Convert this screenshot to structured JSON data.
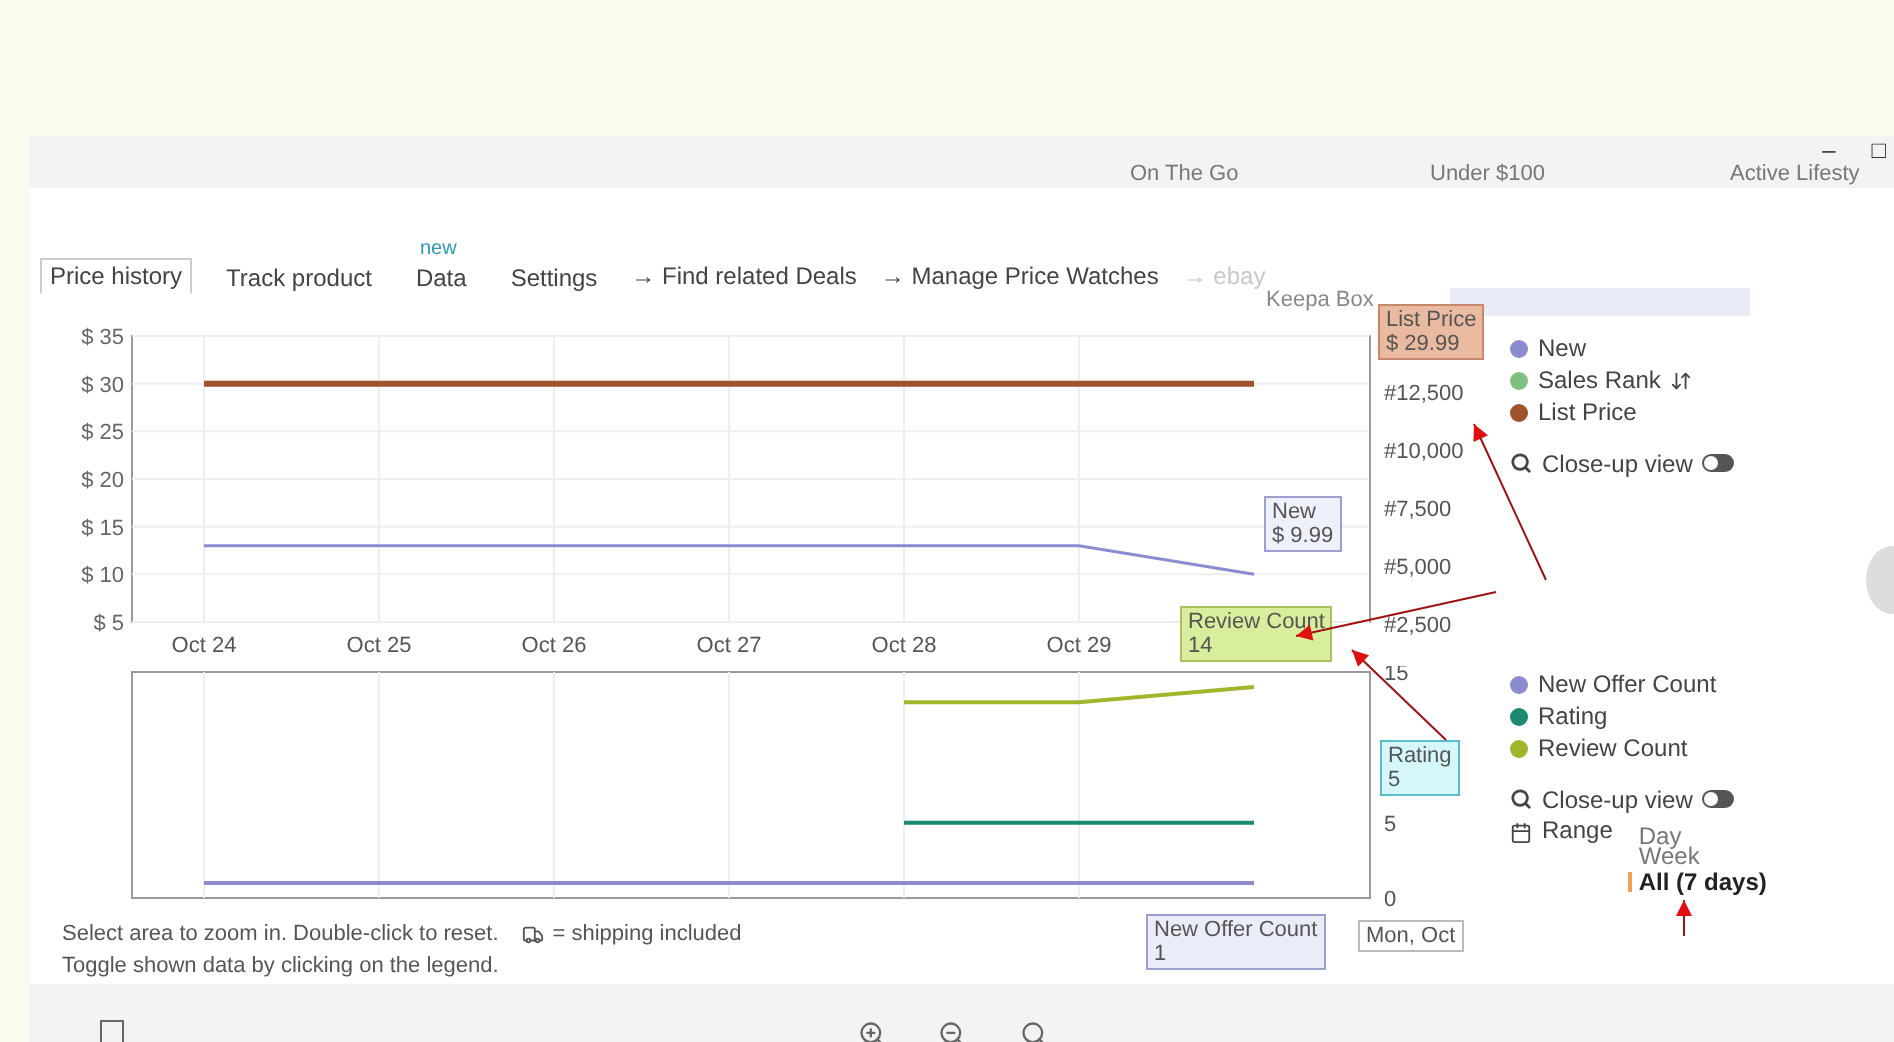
{
  "window": {
    "controls": [
      "–",
      "□"
    ]
  },
  "nav": [
    "On The Go",
    "Under $100",
    "Active Lifesty"
  ],
  "tabs": [
    {
      "label": "Price history",
      "selected": true
    },
    {
      "label": "Track product",
      "selected": false
    },
    {
      "label": "Data",
      "selected": false,
      "badge": "new"
    },
    {
      "label": "Settings",
      "selected": false
    }
  ],
  "links": [
    {
      "label": "→ Find related Deals",
      "disabled": false
    },
    {
      "label": "→ Manage Price Watches",
      "disabled": false
    },
    {
      "label": "→ ebay",
      "disabled": true
    }
  ],
  "keepa_box": {
    "label": "Keepa Box"
  },
  "price_chart": {
    "chart_data": {
      "type": "line",
      "grid": true,
      "categories": [
        "Oct 24",
        "Oct 25",
        "Oct 26",
        "Oct 27",
        "Oct 28",
        "Oct 29",
        null
      ],
      "ylim": [
        5,
        35
      ],
      "yticks": [
        {
          "value": 5,
          "label": "$ 5"
        },
        {
          "value": 10,
          "label": "$ 10"
        },
        {
          "value": 15,
          "label": "$ 15"
        },
        {
          "value": 20,
          "label": "$ 20"
        },
        {
          "value": 25,
          "label": "$ 25"
        },
        {
          "value": 30,
          "label": "$ 30"
        },
        {
          "value": 35,
          "label": "$ 35"
        }
      ],
      "series": [
        {
          "name": "New",
          "color": "#8a8ccf",
          "values": [
            13,
            13,
            13,
            13,
            13,
            13,
            10
          ]
        },
        {
          "name": "List Price",
          "color": "#a0522d",
          "values": [
            30,
            30,
            30,
            30,
            30,
            30,
            30
          ]
        }
      ]
    },
    "rank_ticks": [
      "#12,500",
      "#10,000",
      "#7,500",
      "#5,000",
      "#2,500"
    ],
    "rank_legend": {
      "label": "Sales Rank",
      "color": "#7fbf7f"
    },
    "closeup": {
      "label": "Close-up view",
      "on": false
    }
  },
  "count_chart": {
    "chart_data": {
      "type": "line",
      "grid": true,
      "categories": [
        null,
        null,
        null,
        null,
        null,
        null,
        null
      ],
      "ylim": [
        0,
        15
      ],
      "yticks": [
        0,
        5,
        15
      ],
      "series": [
        {
          "name": "New Offer Count",
          "color": "#8a8ccf",
          "values": [
            1,
            1,
            1,
            1,
            1,
            1,
            1
          ]
        },
        {
          "name": "Rating",
          "color": "#1a8a72",
          "values": [
            null,
            null,
            null,
            null,
            5,
            5,
            5
          ]
        },
        {
          "name": "Review Count",
          "color": "#a3b52a",
          "values": [
            null,
            null,
            null,
            null,
            13,
            13,
            14
          ]
        }
      ]
    },
    "closeup": {
      "label": "Close-up view",
      "on": false
    },
    "range": {
      "label": "Range",
      "options": [
        {
          "label": "Day",
          "selected": false
        },
        {
          "label": "Week",
          "selected": false
        },
        {
          "label": "All (7 days)",
          "selected": true
        }
      ]
    }
  },
  "callouts": [
    {
      "kind": "list",
      "title": "List Price",
      "value": "$ 29.99"
    },
    {
      "kind": "new",
      "title": "New",
      "value": "$ 9.99"
    },
    {
      "kind": "review",
      "title": "Review Count",
      "value": "14"
    },
    {
      "kind": "rating",
      "title": "Rating",
      "value": "5"
    },
    {
      "kind": "offer",
      "title": "New Offer Count",
      "value": "1"
    },
    {
      "kind": "time",
      "title": "Mon, Oct"
    }
  ],
  "footer": {
    "line1": "Select area to zoom in. Double-click to reset.",
    "shipping": "= shipping included",
    "line2": "Toggle shown data by clicking on the legend."
  }
}
